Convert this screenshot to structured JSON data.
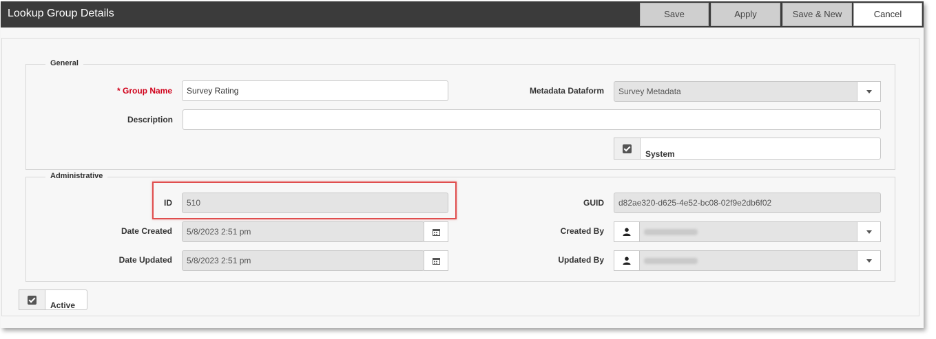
{
  "window": {
    "title": "Lookup Group Details"
  },
  "toolbar": {
    "save": "Save",
    "apply": "Apply",
    "save_new": "Save & New",
    "cancel": "Cancel"
  },
  "general": {
    "legend": "General",
    "group_name_label": "* Group Name",
    "group_name_value": "Survey Rating",
    "description_label": "Description",
    "description_value": "",
    "metadata_label": "Metadata Dataform",
    "metadata_value": "Survey Metadata",
    "system_label": "System",
    "system_checked": true
  },
  "administrative": {
    "legend": "Administrative",
    "id_label": "ID",
    "id_value": "510",
    "guid_label": "GUID",
    "guid_value": "d82ae320-d625-4e52-bc08-02f9e2db6f02",
    "date_created_label": "Date Created",
    "date_created_value": "5/8/2023 2:51 pm",
    "date_updated_label": "Date Updated",
    "date_updated_value": "5/8/2023 2:51 pm",
    "created_by_label": "Created By",
    "updated_by_label": "Updated By"
  },
  "active": {
    "label": "Active",
    "checked": true
  },
  "icons": {
    "calendar": "calendar-icon",
    "user": "user-icon",
    "dropdown": "chevron-down-icon",
    "checkbox": "checkbox-checked-icon"
  },
  "colors": {
    "titlebar": "#3b3b3b",
    "required": "#d0021b",
    "highlight": "#e04e4e"
  }
}
